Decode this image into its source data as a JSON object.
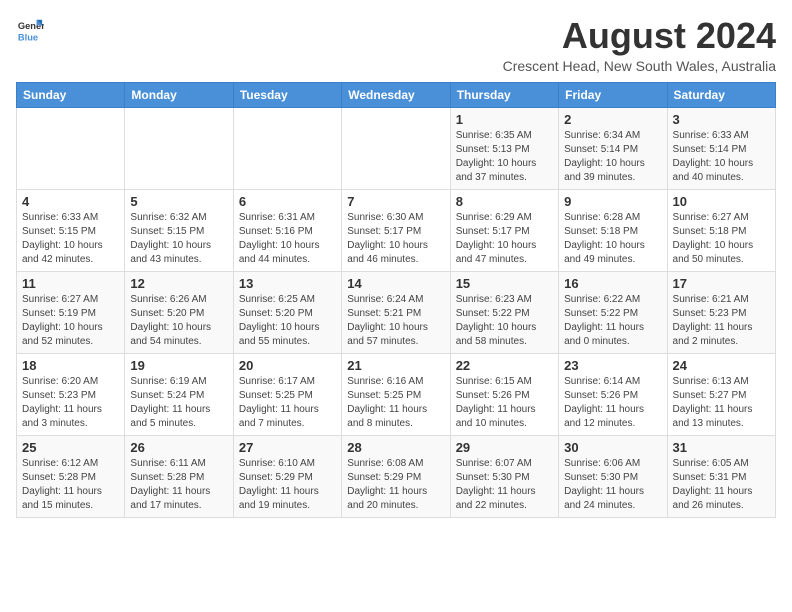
{
  "logo": {
    "text_general": "General",
    "text_blue": "Blue"
  },
  "header": {
    "title": "August 2024",
    "subtitle": "Crescent Head, New South Wales, Australia"
  },
  "weekdays": [
    "Sunday",
    "Monday",
    "Tuesday",
    "Wednesday",
    "Thursday",
    "Friday",
    "Saturday"
  ],
  "weeks": [
    [
      {
        "day": "",
        "info": ""
      },
      {
        "day": "",
        "info": ""
      },
      {
        "day": "",
        "info": ""
      },
      {
        "day": "",
        "info": ""
      },
      {
        "day": "1",
        "info": "Sunrise: 6:35 AM\nSunset: 5:13 PM\nDaylight: 10 hours\nand 37 minutes."
      },
      {
        "day": "2",
        "info": "Sunrise: 6:34 AM\nSunset: 5:14 PM\nDaylight: 10 hours\nand 39 minutes."
      },
      {
        "day": "3",
        "info": "Sunrise: 6:33 AM\nSunset: 5:14 PM\nDaylight: 10 hours\nand 40 minutes."
      }
    ],
    [
      {
        "day": "4",
        "info": "Sunrise: 6:33 AM\nSunset: 5:15 PM\nDaylight: 10 hours\nand 42 minutes."
      },
      {
        "day": "5",
        "info": "Sunrise: 6:32 AM\nSunset: 5:15 PM\nDaylight: 10 hours\nand 43 minutes."
      },
      {
        "day": "6",
        "info": "Sunrise: 6:31 AM\nSunset: 5:16 PM\nDaylight: 10 hours\nand 44 minutes."
      },
      {
        "day": "7",
        "info": "Sunrise: 6:30 AM\nSunset: 5:17 PM\nDaylight: 10 hours\nand 46 minutes."
      },
      {
        "day": "8",
        "info": "Sunrise: 6:29 AM\nSunset: 5:17 PM\nDaylight: 10 hours\nand 47 minutes."
      },
      {
        "day": "9",
        "info": "Sunrise: 6:28 AM\nSunset: 5:18 PM\nDaylight: 10 hours\nand 49 minutes."
      },
      {
        "day": "10",
        "info": "Sunrise: 6:27 AM\nSunset: 5:18 PM\nDaylight: 10 hours\nand 50 minutes."
      }
    ],
    [
      {
        "day": "11",
        "info": "Sunrise: 6:27 AM\nSunset: 5:19 PM\nDaylight: 10 hours\nand 52 minutes."
      },
      {
        "day": "12",
        "info": "Sunrise: 6:26 AM\nSunset: 5:20 PM\nDaylight: 10 hours\nand 54 minutes."
      },
      {
        "day": "13",
        "info": "Sunrise: 6:25 AM\nSunset: 5:20 PM\nDaylight: 10 hours\nand 55 minutes."
      },
      {
        "day": "14",
        "info": "Sunrise: 6:24 AM\nSunset: 5:21 PM\nDaylight: 10 hours\nand 57 minutes."
      },
      {
        "day": "15",
        "info": "Sunrise: 6:23 AM\nSunset: 5:22 PM\nDaylight: 10 hours\nand 58 minutes."
      },
      {
        "day": "16",
        "info": "Sunrise: 6:22 AM\nSunset: 5:22 PM\nDaylight: 11 hours\nand 0 minutes."
      },
      {
        "day": "17",
        "info": "Sunrise: 6:21 AM\nSunset: 5:23 PM\nDaylight: 11 hours\nand 2 minutes."
      }
    ],
    [
      {
        "day": "18",
        "info": "Sunrise: 6:20 AM\nSunset: 5:23 PM\nDaylight: 11 hours\nand 3 minutes."
      },
      {
        "day": "19",
        "info": "Sunrise: 6:19 AM\nSunset: 5:24 PM\nDaylight: 11 hours\nand 5 minutes."
      },
      {
        "day": "20",
        "info": "Sunrise: 6:17 AM\nSunset: 5:25 PM\nDaylight: 11 hours\nand 7 minutes."
      },
      {
        "day": "21",
        "info": "Sunrise: 6:16 AM\nSunset: 5:25 PM\nDaylight: 11 hours\nand 8 minutes."
      },
      {
        "day": "22",
        "info": "Sunrise: 6:15 AM\nSunset: 5:26 PM\nDaylight: 11 hours\nand 10 minutes."
      },
      {
        "day": "23",
        "info": "Sunrise: 6:14 AM\nSunset: 5:26 PM\nDaylight: 11 hours\nand 12 minutes."
      },
      {
        "day": "24",
        "info": "Sunrise: 6:13 AM\nSunset: 5:27 PM\nDaylight: 11 hours\nand 13 minutes."
      }
    ],
    [
      {
        "day": "25",
        "info": "Sunrise: 6:12 AM\nSunset: 5:28 PM\nDaylight: 11 hours\nand 15 minutes."
      },
      {
        "day": "26",
        "info": "Sunrise: 6:11 AM\nSunset: 5:28 PM\nDaylight: 11 hours\nand 17 minutes."
      },
      {
        "day": "27",
        "info": "Sunrise: 6:10 AM\nSunset: 5:29 PM\nDaylight: 11 hours\nand 19 minutes."
      },
      {
        "day": "28",
        "info": "Sunrise: 6:08 AM\nSunset: 5:29 PM\nDaylight: 11 hours\nand 20 minutes."
      },
      {
        "day": "29",
        "info": "Sunrise: 6:07 AM\nSunset: 5:30 PM\nDaylight: 11 hours\nand 22 minutes."
      },
      {
        "day": "30",
        "info": "Sunrise: 6:06 AM\nSunset: 5:30 PM\nDaylight: 11 hours\nand 24 minutes."
      },
      {
        "day": "31",
        "info": "Sunrise: 6:05 AM\nSunset: 5:31 PM\nDaylight: 11 hours\nand 26 minutes."
      }
    ]
  ]
}
